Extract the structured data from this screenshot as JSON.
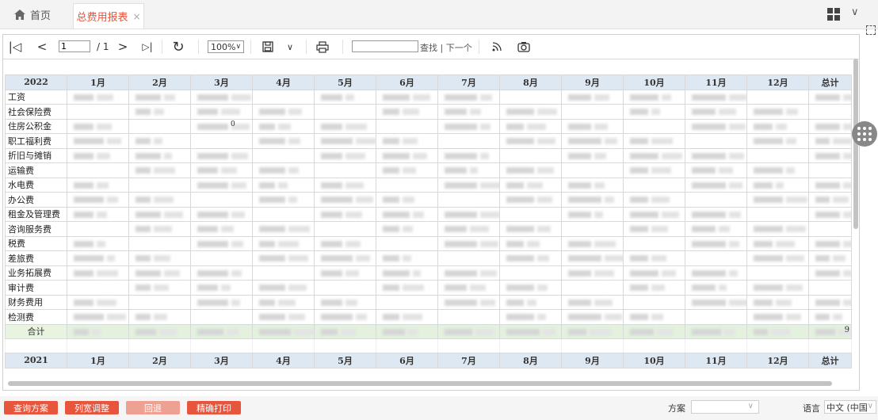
{
  "tabs": {
    "home_label": "首页",
    "active_label": "总费用报表",
    "close_symbol": "×"
  },
  "toolbar": {
    "first_page": "|◁",
    "prev_page": "<",
    "current_page": "1",
    "total_pages": "/ 1",
    "next_page": ">",
    "last_page": "▷|",
    "refresh": "↻",
    "zoom": "100%",
    "save": "🖫",
    "save_dropdown": "∨",
    "print": "⎙",
    "search_label": "查找",
    "next_match": "下一个",
    "search_separator": " | "
  },
  "report": {
    "header_2022": [
      "2022",
      "1月",
      "2月",
      "3月",
      "4月",
      "5月",
      "6月",
      "7月",
      "8月",
      "9月",
      "10月",
      "11月",
      "12月",
      "总计"
    ],
    "rows": [
      "工资",
      "社会保险费",
      "住房公积金",
      "职工福利费",
      "折旧与摊销",
      "运输费",
      "水电费",
      "办公费",
      "租金及管理费",
      "咨询服务费",
      "税费",
      "差旅费",
      "业务拓展费",
      "审计费",
      "财务费用",
      "检测费"
    ],
    "total_label": "合计",
    "header_2021": [
      "2021",
      "1月",
      "2月",
      "3月",
      "4月",
      "5月",
      "6月",
      "7月",
      "8月",
      "9月",
      "10月",
      "11月",
      "12月",
      "总计"
    ],
    "stray_text": {
      "zero": "0",
      "nine": "9"
    }
  },
  "bottombar": {
    "query_scheme": "查询方案",
    "column_width": "列宽调整",
    "back": "回退",
    "precise_print": "精确打印",
    "plan_label": "方案",
    "language_label": "语言",
    "language_value": "中文 (中国"
  },
  "colors": {
    "accent": "#e8553d",
    "header_bg": "#dde8f3",
    "total_bg": "#e3f1de"
  }
}
